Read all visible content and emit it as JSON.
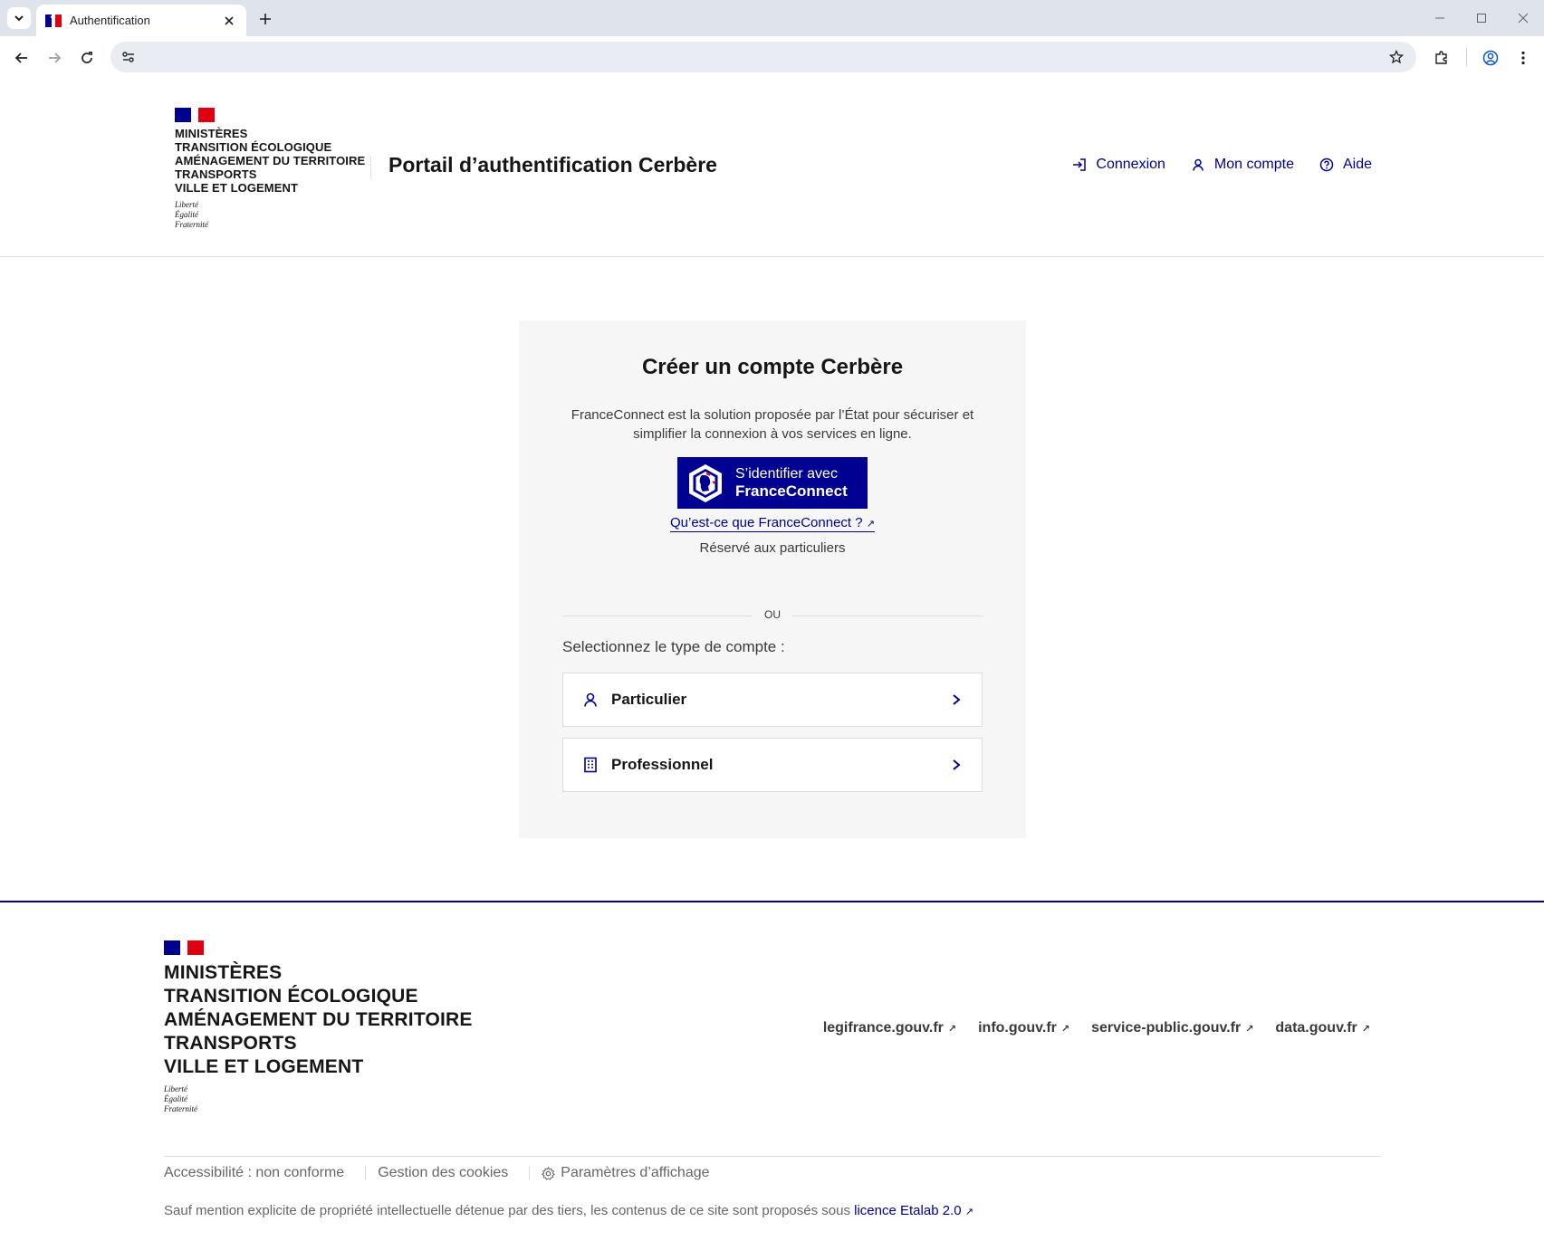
{
  "browser": {
    "tab_title": "Authentification",
    "url": ""
  },
  "header": {
    "ministry_lines": [
      "MINISTÈRES",
      "TRANSITION ÉCOLOGIQUE",
      "AMÉNAGEMENT DU TERRITOIRE",
      "TRANSPORTS",
      "VILLE ET LOGEMENT"
    ],
    "devise": [
      "Liberté",
      "Égalité",
      "Fraternité"
    ],
    "service_title": "Portail d’authentification Cerbère",
    "quick_links": [
      {
        "label": "Connexion",
        "icon": "login-icon"
      },
      {
        "label": "Mon compte",
        "icon": "user-icon"
      },
      {
        "label": "Aide",
        "icon": "help-icon"
      }
    ]
  },
  "card": {
    "title": "Créer un compte Cerbère",
    "intro": "FranceConnect est la solution proposée par l’État pour sécuriser et simplifier la connexion à vos services en ligne.",
    "fc_button": {
      "line1": "S’identifier avec",
      "line2": "FranceConnect"
    },
    "fc_what": "Qu’est-ce que FranceConnect ?",
    "fc_reserved": "Réservé aux particuliers",
    "divider_label": "OU",
    "select_label": "Selectionnez le type de compte :",
    "account_types": [
      {
        "label": "Particulier",
        "icon": "user-icon"
      },
      {
        "label": "Professionnel",
        "icon": "building-icon"
      }
    ]
  },
  "footer": {
    "ministry_lines": [
      "MINISTÈRES",
      "TRANSITION ÉCOLOGIQUE",
      "AMÉNAGEMENT DU TERRITOIRE",
      "TRANSPORTS",
      "VILLE ET LOGEMENT"
    ],
    "devise": [
      "Liberté",
      "Égalité",
      "Fraternité"
    ],
    "links": [
      "legifrance.gouv.fr",
      "info.gouv.fr",
      "service-public.gouv.fr",
      "data.gouv.fr"
    ],
    "bottom": {
      "accessibility": "Accessibilité : non conforme",
      "cookies": "Gestion des cookies",
      "display": "Paramètres d’affichage"
    },
    "license_text": "Sauf mention explicite de propriété intellectuelle détenue par des tiers, les contenus de ce site sont proposés sous",
    "license_link": "licence Etalab 2.0"
  },
  "colors": {
    "blue_france": "#000091",
    "red_marianne": "#e1000f",
    "card_bg": "#f6f6f6"
  }
}
